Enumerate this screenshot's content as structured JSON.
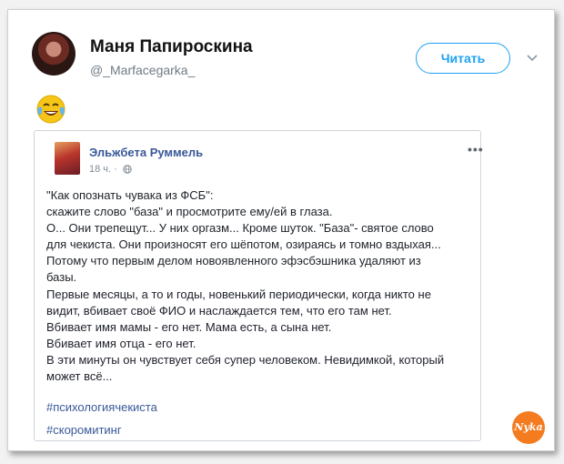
{
  "tweet": {
    "author_name": "Маня Папироскина",
    "author_handle": "@_Marfacegarka_",
    "follow_label": "Читать",
    "emoji": "😂"
  },
  "fb_post": {
    "author_name": "Эльжбета Руммель",
    "time": "18 ч. ·",
    "menu_dots": "•••",
    "lines": [
      "\"Как опознать чувака из ФСБ\":",
      "скажите слово \"база\" и просмотрите ему/ей в глаза.",
      "О... Они трепещут... У них оргазм... Кроме шуток. \"База\"- святое слово",
      "для чекиста. Они произносят его шёпотом, озираясь и томно вздыхая...",
      "Потому что первым делом новоявленного эфэсбэшника удаляют из",
      "базы.",
      "Первые месяцы, а то и годы, новенький периодически, когда никто не",
      "видит, вбивает своё ФИО и наслаждается тем, что его там нет.",
      "Вбивает имя мамы - его нет. Мама есть, а сына нет.",
      "Вбивает имя отца - его нет.",
      "В эти минуты он чувствует себя супер человеком. Невидимкой, который",
      "может всё..."
    ],
    "hashtags": [
      "#психологиячекиста",
      "#скоромитинг"
    ]
  },
  "watermark": "Nyka",
  "colors": {
    "twitter_blue": "#1da1f2",
    "fb_link": "#385898",
    "watermark": "#f47b20"
  }
}
